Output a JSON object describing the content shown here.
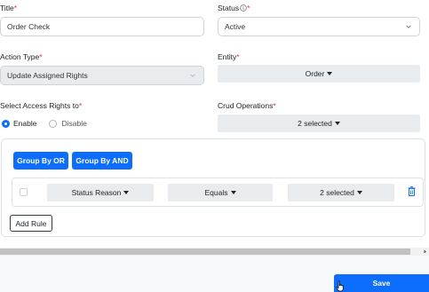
{
  "form": {
    "title_label": "Title",
    "title_value": "Order Check",
    "status_label": "Status",
    "status_value": "Active",
    "action_type_label": "Action Type",
    "action_type_value": "Update Assigned Rights",
    "entity_label": "Entity",
    "entity_value": "Order",
    "access_rights_label": "Select Access Rights to",
    "enable_label": "Enable",
    "disable_label": "Disable",
    "crud_label": "Crud Operations",
    "crud_value": "2 selected",
    "required_mark": "*"
  },
  "rules": {
    "group_by_or": "Group By OR",
    "group_by_and": "Group By AND",
    "field_value": "Status Reason",
    "operator_value": "Equals",
    "rule_value": "2 selected",
    "add_rule": "Add Rule"
  },
  "footer": {
    "save_label": "Save"
  },
  "colors": {
    "accent": "#0d6efd",
    "required": "#dc3545"
  }
}
